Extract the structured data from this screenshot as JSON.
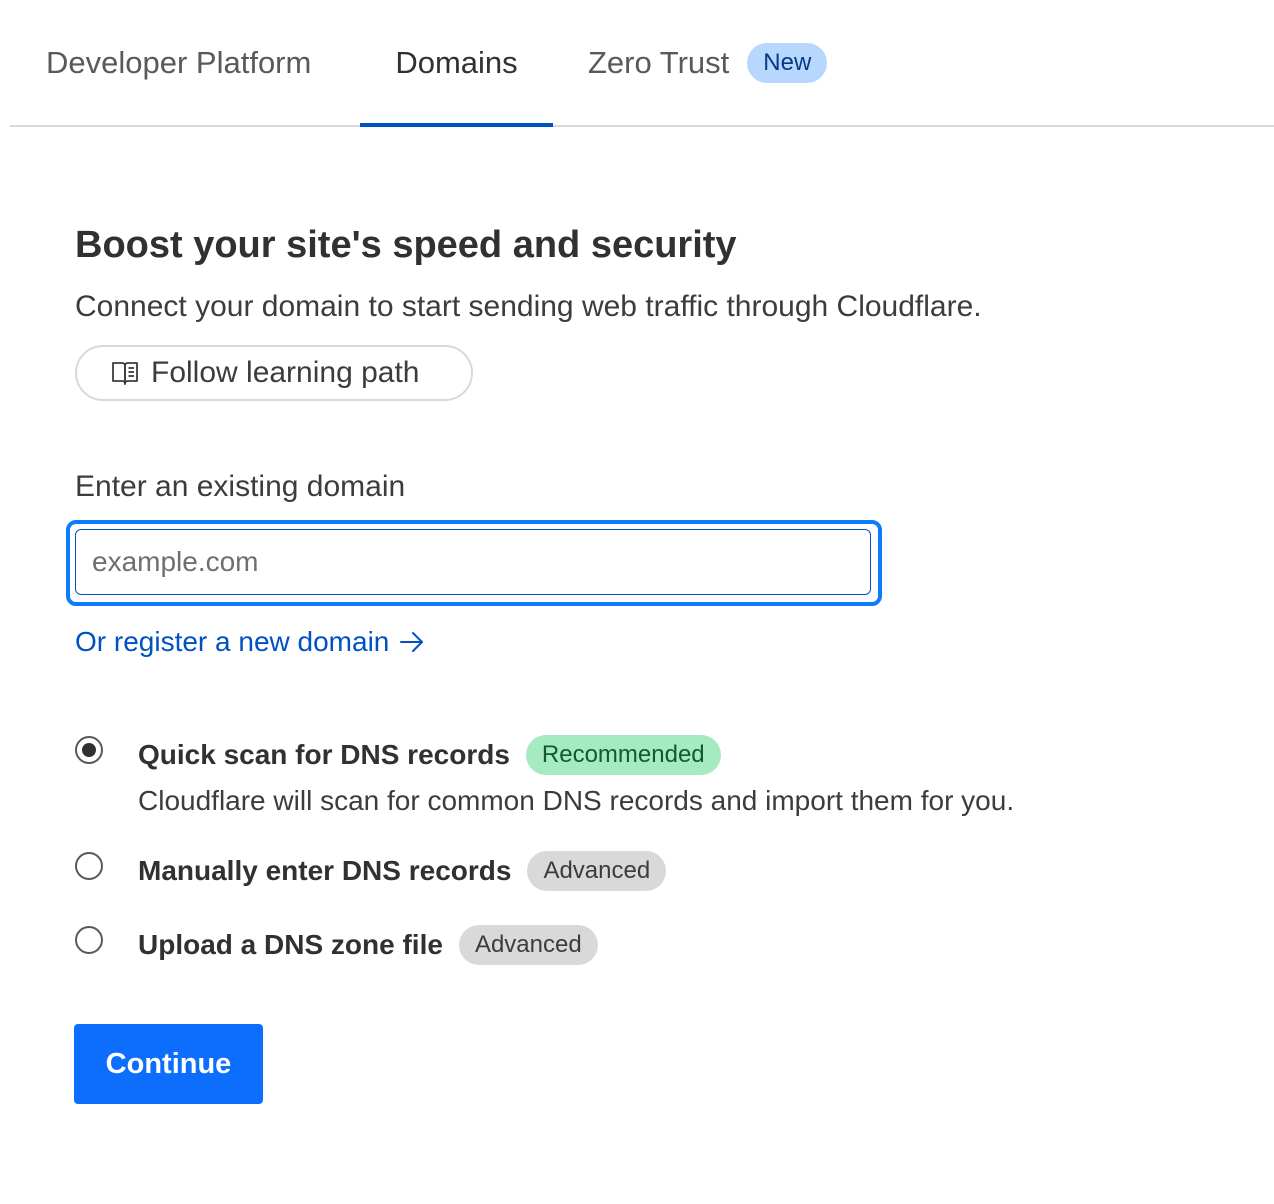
{
  "tabs": [
    {
      "label": "Developer Platform",
      "active": false
    },
    {
      "label": "Domains",
      "active": true
    },
    {
      "label": "Zero Trust",
      "active": false,
      "badge": "New"
    }
  ],
  "main": {
    "heading": "Boost your site's speed and security",
    "subheading": "Connect your domain to start sending web traffic through Cloudflare.",
    "learning_button": {
      "label": "Follow learning path",
      "icon": "book-icon"
    },
    "domain_field": {
      "label": "Enter an existing domain",
      "value": "",
      "placeholder": "example.com"
    },
    "register_link": {
      "label": "Or register a new domain",
      "icon": "arrow-right-icon"
    },
    "options": [
      {
        "title": "Quick scan for DNS records",
        "badge": "Recommended",
        "description": "Cloudflare will scan for common DNS records and import them for you.",
        "selected": true
      },
      {
        "title": "Manually enter DNS records",
        "badge": "Advanced",
        "selected": false
      },
      {
        "title": "Upload a DNS zone file",
        "badge": "Advanced",
        "selected": false
      }
    ],
    "continue_label": "Continue"
  },
  "colors": {
    "accent": "#0051c3",
    "primary_button": "#0d6efd",
    "new_badge": "#b8d7ff",
    "recommended_badge": "#a5eac0",
    "advanced_badge": "#d9d9d9"
  }
}
